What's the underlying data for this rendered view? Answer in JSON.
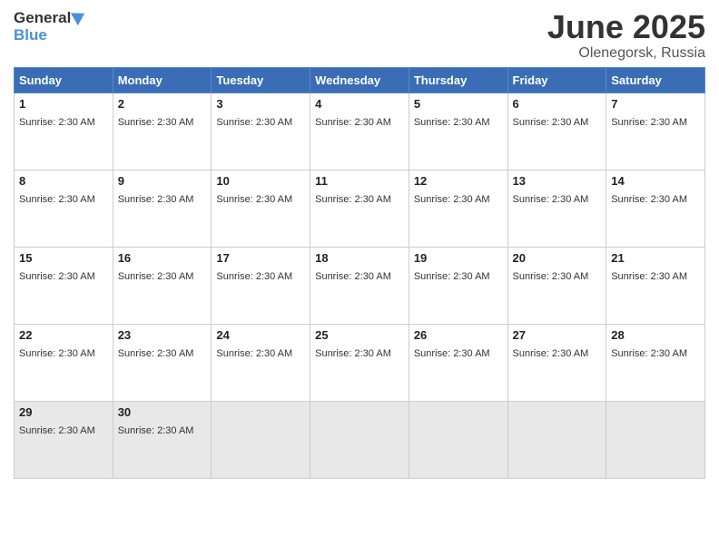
{
  "header": {
    "logo_general": "General",
    "logo_blue": "Blue",
    "title_month": "June 2025",
    "title_location": "Olenegorsk, Russia"
  },
  "calendar": {
    "days_of_week": [
      "Sunday",
      "Monday",
      "Tuesday",
      "Wednesday",
      "Thursday",
      "Friday",
      "Saturday"
    ],
    "weeks": [
      [
        {
          "day": "1",
          "info": "Sunrise: 2:30 AM",
          "empty": false
        },
        {
          "day": "2",
          "info": "Sunrise: 2:30 AM",
          "empty": false
        },
        {
          "day": "3",
          "info": "Sunrise: 2:30 AM",
          "empty": false
        },
        {
          "day": "4",
          "info": "Sunrise: 2:30 AM",
          "empty": false
        },
        {
          "day": "5",
          "info": "Sunrise: 2:30 AM",
          "empty": false
        },
        {
          "day": "6",
          "info": "Sunrise: 2:30 AM",
          "empty": false
        },
        {
          "day": "7",
          "info": "Sunrise: 2:30 AM",
          "empty": false
        }
      ],
      [
        {
          "day": "8",
          "info": "Sunrise: 2:30 AM",
          "empty": false
        },
        {
          "day": "9",
          "info": "Sunrise: 2:30 AM",
          "empty": false
        },
        {
          "day": "10",
          "info": "Sunrise: 2:30 AM",
          "empty": false
        },
        {
          "day": "11",
          "info": "Sunrise: 2:30 AM",
          "empty": false
        },
        {
          "day": "12",
          "info": "Sunrise: 2:30 AM",
          "empty": false
        },
        {
          "day": "13",
          "info": "Sunrise: 2:30 AM",
          "empty": false
        },
        {
          "day": "14",
          "info": "Sunrise: 2:30 AM",
          "empty": false
        }
      ],
      [
        {
          "day": "15",
          "info": "Sunrise: 2:30 AM",
          "empty": false
        },
        {
          "day": "16",
          "info": "Sunrise: 2:30 AM",
          "empty": false
        },
        {
          "day": "17",
          "info": "Sunrise: 2:30 AM",
          "empty": false
        },
        {
          "day": "18",
          "info": "Sunrise: 2:30 AM",
          "empty": false
        },
        {
          "day": "19",
          "info": "Sunrise: 2:30 AM",
          "empty": false
        },
        {
          "day": "20",
          "info": "Sunrise: 2:30 AM",
          "empty": false
        },
        {
          "day": "21",
          "info": "Sunrise: 2:30 AM",
          "empty": false
        }
      ],
      [
        {
          "day": "22",
          "info": "Sunrise: 2:30 AM",
          "empty": false
        },
        {
          "day": "23",
          "info": "Sunrise: 2:30 AM",
          "empty": false
        },
        {
          "day": "24",
          "info": "Sunrise: 2:30 AM",
          "empty": false
        },
        {
          "day": "25",
          "info": "Sunrise: 2:30 AM",
          "empty": false
        },
        {
          "day": "26",
          "info": "Sunrise: 2:30 AM",
          "empty": false
        },
        {
          "day": "27",
          "info": "Sunrise: 2:30 AM",
          "empty": false
        },
        {
          "day": "28",
          "info": "Sunrise: 2:30 AM",
          "empty": false
        }
      ],
      [
        {
          "day": "29",
          "info": "Sunrise: 2:30 AM",
          "empty": false
        },
        {
          "day": "30",
          "info": "Sunrise: 2:30 AM",
          "empty": false
        },
        {
          "day": "",
          "info": "",
          "empty": true
        },
        {
          "day": "",
          "info": "",
          "empty": true
        },
        {
          "day": "",
          "info": "",
          "empty": true
        },
        {
          "day": "",
          "info": "",
          "empty": true
        },
        {
          "day": "",
          "info": "",
          "empty": true
        }
      ]
    ]
  }
}
